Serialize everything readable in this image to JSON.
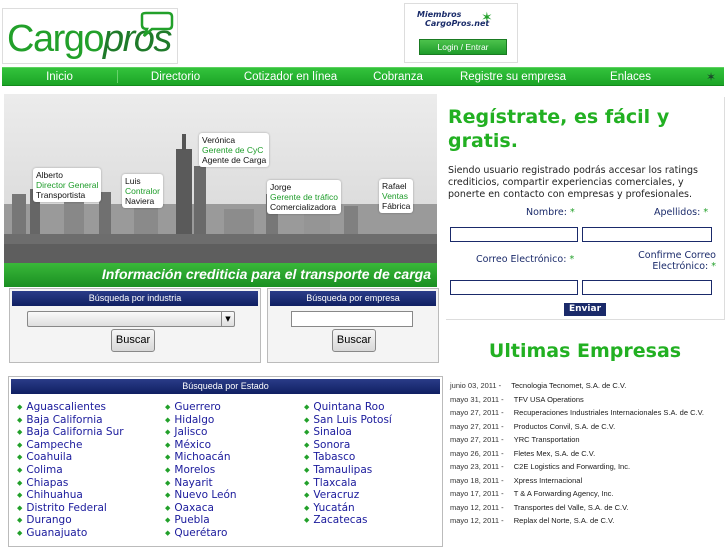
{
  "header": {
    "logo_part1": "Cargo",
    "logo_part2": "pros",
    "members_line1": "Miembros",
    "members_line2": "CargoPros.net",
    "login_label": "Login / Entrar"
  },
  "nav": [
    "Inicio",
    "Directorio",
    "Cotizador en línea",
    "Cobranza",
    "Registre su empresa",
    "Enlaces"
  ],
  "hero": {
    "banner": "Información crediticia para el transporte de carga",
    "people": [
      {
        "name": "Alberto",
        "role": "Director General",
        "title": "Transportista"
      },
      {
        "name": "Luis",
        "role": "Contralor",
        "title": "Naviera"
      },
      {
        "name": "Verónica",
        "role": "Gerente de CyC",
        "title": "Agente de Carga"
      },
      {
        "name": "Jorge",
        "role": "Gerente de tráfico",
        "title": "Comercializadora"
      },
      {
        "name": "Rafael",
        "role": "Ventas",
        "title": "Fábrica"
      }
    ]
  },
  "search_industry": {
    "header": "Búsqueda por industria",
    "button": "Buscar",
    "selected": ""
  },
  "search_company": {
    "header": "Búsqueda por empresa",
    "button": "Buscar",
    "value": ""
  },
  "states": {
    "header": "Búsqueda por Estado",
    "col1": [
      "Aguascalientes",
      "Baja California",
      "Baja California Sur",
      "Campeche",
      "Coahuila",
      "Colima",
      "Chiapas",
      "Chihuahua",
      "Distrito Federal",
      "Durango",
      "Guanajuato"
    ],
    "col2": [
      "Guerrero",
      "Hidalgo",
      "Jalisco",
      "México",
      "Michoacán",
      "Morelos",
      "Nayarit",
      "Nuevo León",
      "Oaxaca",
      "Puebla",
      "Querétaro"
    ],
    "col3": [
      "Quintana Roo",
      "San Luis Potosí",
      "Sinaloa",
      "Sonora",
      "Tabasco",
      "Tamaulipas",
      "Tlaxcala",
      "Veracruz",
      "Yucatán",
      "Zacatecas"
    ]
  },
  "register": {
    "title": "Regístrate, es fácil y gratis.",
    "description": "Siendo usuario registrado podrás accesar los ratings crediticios, compartir experiencias comerciales, y ponerte en contacto con empresas y profesionales.",
    "name_label": "Nombre:",
    "lastname_label": "Apellidos:",
    "email_label": "Correo Electrónico:",
    "confirm_label": "Confirme Correo Electrónico:",
    "required_mark": "*",
    "submit": "Enviar"
  },
  "latest": {
    "title": "Ultimas Empresas",
    "items": [
      {
        "date": "junio 03, 2011",
        "company": "Tecnologia Tecnomet, S.A. de C.V."
      },
      {
        "date": "mayo 31, 2011",
        "company": "TFV USA Operations"
      },
      {
        "date": "mayo 27, 2011",
        "company": "Recuperaciones Industriales Internacionales S.A. de C.V."
      },
      {
        "date": "mayo 27, 2011",
        "company": "Productos Convil, S.A. de C.V."
      },
      {
        "date": "mayo 27, 2011",
        "company": "YRC Transportation"
      },
      {
        "date": "mayo 26, 2011",
        "company": "Fletes Mex, S.A. de C.V."
      },
      {
        "date": "mayo 23, 2011",
        "company": "C2E Logistics and Forwarding, Inc."
      },
      {
        "date": "mayo 18, 2011",
        "company": "Xpress Internacional"
      },
      {
        "date": "mayo 17, 2011",
        "company": "T & A Forwarding Agency, Inc."
      },
      {
        "date": "mayo 12, 2011",
        "company": "Transportes del Valle, S.A. de C.V."
      },
      {
        "date": "mayo 12, 2011",
        "company": "Replax del Norte, S.A. de C.V."
      }
    ]
  },
  "colors": {
    "green": "#22a02a",
    "navy": "#1a2a6a",
    "link": "#1a1a9c"
  }
}
